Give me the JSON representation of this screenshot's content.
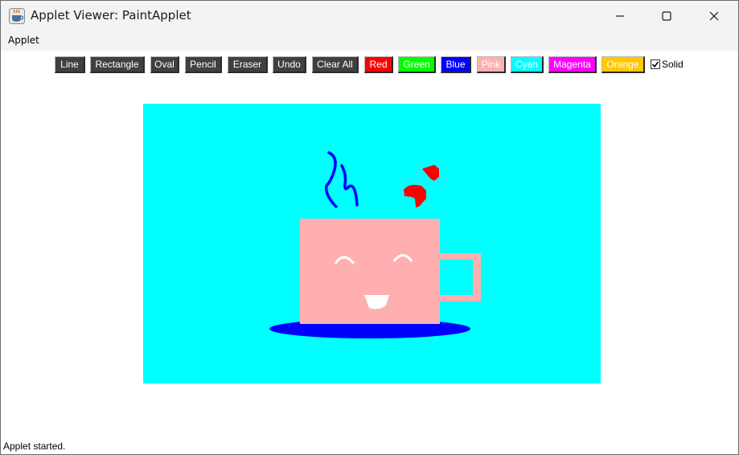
{
  "window": {
    "title": "Applet Viewer: PaintApplet",
    "icon": "java-cup-icon"
  },
  "menubar": {
    "items": [
      "Applet"
    ]
  },
  "toolbar": {
    "tools": [
      "Line",
      "Rectangle",
      "Oval",
      "Pencil",
      "Eraser",
      "Undo",
      "Clear All"
    ],
    "colors": [
      {
        "label": "Red",
        "bg": "#ff0000",
        "fg": "#ffffff"
      },
      {
        "label": "Green",
        "bg": "#00ff00",
        "fg": "#ffffff"
      },
      {
        "label": "Blue",
        "bg": "#0000ff",
        "fg": "#ffffff"
      },
      {
        "label": "Pink",
        "bg": "#ffafaf",
        "fg": "#ffffff"
      },
      {
        "label": "Cyan",
        "bg": "#00ffff",
        "fg": "#ffffff"
      },
      {
        "label": "Magenta",
        "bg": "#ff00ff",
        "fg": "#ffffff"
      },
      {
        "label": "Orange",
        "bg": "#ffc800",
        "fg": "#ffffff"
      }
    ],
    "solid": {
      "label": "Solid",
      "checked": true
    }
  },
  "canvas": {
    "background": "#00ffff",
    "drawing": "cup of coffee with smiling face, steam and hearts",
    "colors": {
      "cup": "#ffafaf",
      "saucer": "#0000ff",
      "steam": "#0000ff",
      "hearts": "#ff0000",
      "face": "#ffffff"
    }
  },
  "status": {
    "text": "Applet started."
  }
}
